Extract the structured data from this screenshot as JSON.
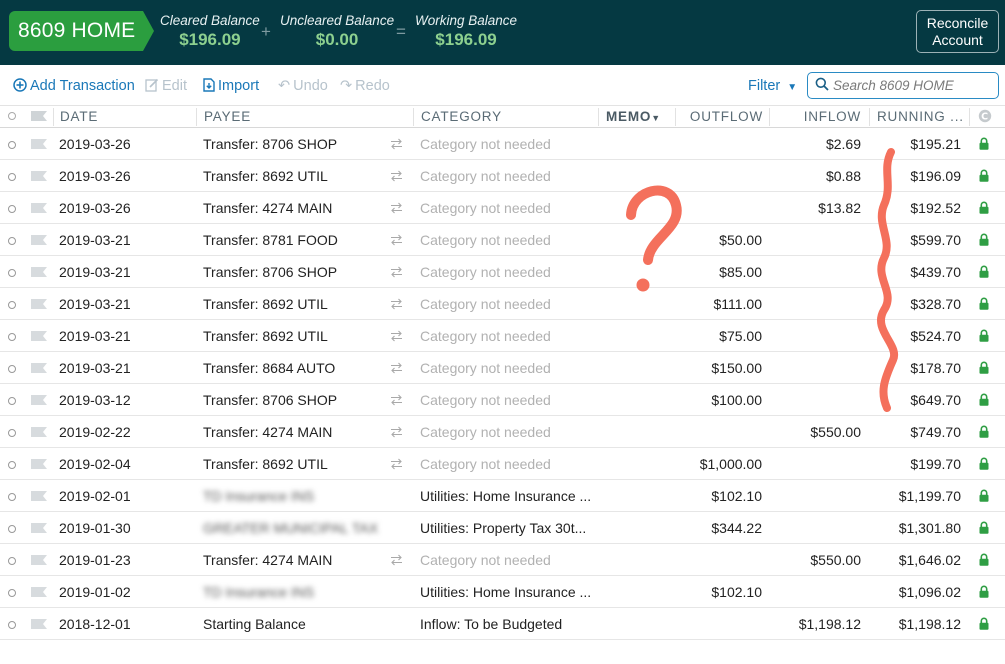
{
  "header": {
    "account_name": "8609 HOME",
    "cleared_label": "Cleared Balance",
    "cleared_value": "$196.09",
    "plus": "+",
    "uncleared_label": "Uncleared Balance",
    "uncleared_value": "$0.00",
    "equals": "=",
    "working_label": "Working Balance",
    "working_value": "$196.09",
    "reconcile_line1": "Reconcile",
    "reconcile_line2": "Account"
  },
  "toolbar": {
    "add": "Add Transaction",
    "edit": "Edit",
    "import": "Import",
    "undo": "Undo",
    "redo": "Redo",
    "filter": "Filter",
    "search_placeholder": "Search 8609 HOME"
  },
  "columns": {
    "date": "DATE",
    "payee": "PAYEE",
    "category": "CATEGORY",
    "memo": "MEMO",
    "outflow": "OUTFLOW",
    "inflow": "INFLOW",
    "running": "RUNNING ..."
  },
  "colors": {
    "header_bg": "#053942",
    "account_green": "#2b9e3f",
    "balance_green": "#8dd08f",
    "link_blue": "#1a78b8",
    "lock_green": "#2f9e44",
    "annotation": "#f4705c"
  },
  "rows": [
    {
      "date": "2019-03-26",
      "payee": "Transfer: 8706 SHOP",
      "category": "Category not needed",
      "outflow": "",
      "inflow": "$2.69",
      "running": "$195.21"
    },
    {
      "date": "2019-03-26",
      "payee": "Transfer: 8692 UTIL",
      "category": "Category not needed",
      "outflow": "",
      "inflow": "$0.88",
      "running": "$196.09"
    },
    {
      "date": "2019-03-26",
      "payee": "Transfer: 4274 MAIN",
      "category": "Category not needed",
      "outflow": "",
      "inflow": "$13.82",
      "running": "$192.52"
    },
    {
      "date": "2019-03-21",
      "payee": "Transfer: 8781 FOOD",
      "category": "Category not needed",
      "outflow": "$50.00",
      "inflow": "",
      "running": "$599.70"
    },
    {
      "date": "2019-03-21",
      "payee": "Transfer: 8706 SHOP",
      "category": "Category not needed",
      "outflow": "$85.00",
      "inflow": "",
      "running": "$439.70"
    },
    {
      "date": "2019-03-21",
      "payee": "Transfer: 8692 UTIL",
      "category": "Category not needed",
      "outflow": "$111.00",
      "inflow": "",
      "running": "$328.70"
    },
    {
      "date": "2019-03-21",
      "payee": "Transfer: 8692 UTIL",
      "category": "Category not needed",
      "outflow": "$75.00",
      "inflow": "",
      "running": "$524.70"
    },
    {
      "date": "2019-03-21",
      "payee": "Transfer: 8684 AUTO",
      "category": "Category not needed",
      "outflow": "$150.00",
      "inflow": "",
      "running": "$178.70"
    },
    {
      "date": "2019-03-12",
      "payee": "Transfer: 8706 SHOP",
      "category": "Category not needed",
      "outflow": "$100.00",
      "inflow": "",
      "running": "$649.70"
    },
    {
      "date": "2019-02-22",
      "payee": "Transfer: 4274 MAIN",
      "category": "Category not needed",
      "outflow": "",
      "inflow": "$550.00",
      "running": "$749.70"
    },
    {
      "date": "2019-02-04",
      "payee": "Transfer: 8692 UTIL",
      "category": "Category not needed",
      "outflow": "$1,000.00",
      "inflow": "",
      "running": "$199.70"
    },
    {
      "date": "2019-02-01",
      "payee": "TD Insurance INS",
      "category": "Utilities: Home Insurance ...",
      "outflow": "$102.10",
      "inflow": "",
      "running": "$1,199.70"
    },
    {
      "date": "2019-01-30",
      "payee": "GREATER MUNICIPAL TAX",
      "category": "Utilities: Property Tax 30t...",
      "outflow": "$344.22",
      "inflow": "",
      "running": "$1,301.80"
    },
    {
      "date": "2019-01-23",
      "payee": "Transfer: 4274 MAIN",
      "category": "Category not needed",
      "outflow": "",
      "inflow": "$550.00",
      "running": "$1,646.02"
    },
    {
      "date": "2019-01-02",
      "payee": "TD Insurance INS",
      "category": "Utilities: Home Insurance ...",
      "outflow": "$102.10",
      "inflow": "",
      "running": "$1,096.02"
    },
    {
      "date": "2018-12-01",
      "payee": "Starting Balance",
      "category": "Inflow: To be Budgeted",
      "outflow": "",
      "inflow": "$1,198.12",
      "running": "$1,198.12"
    }
  ]
}
